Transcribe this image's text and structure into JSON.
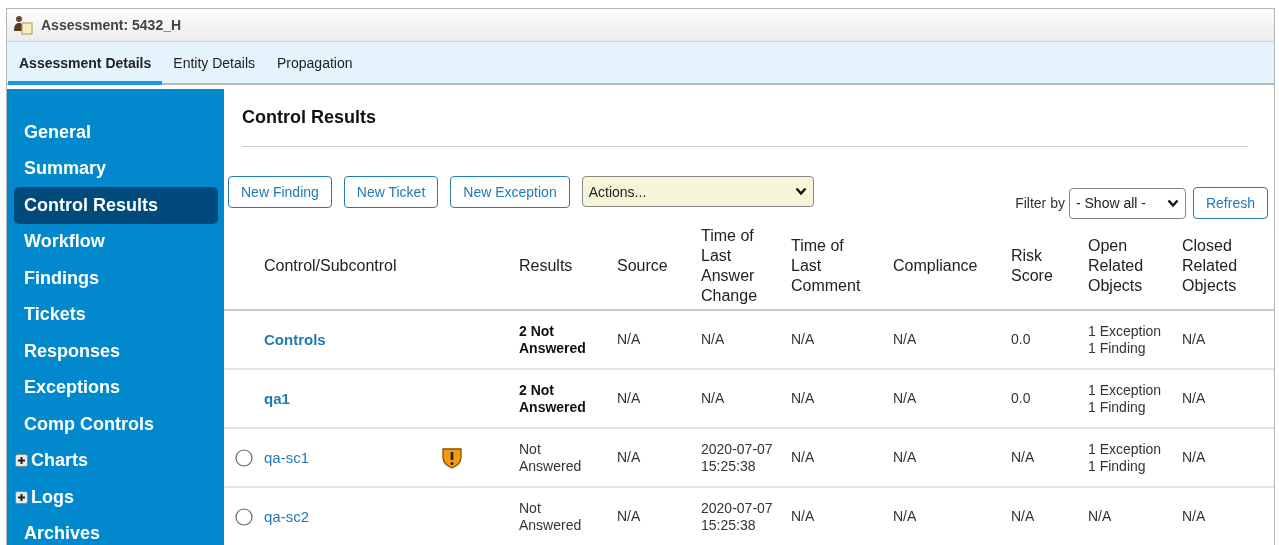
{
  "window": {
    "title": "Assessment: 5432_H"
  },
  "tabs": [
    {
      "label": "Assessment Details",
      "selected": true
    },
    {
      "label": "Entity Details",
      "selected": false
    },
    {
      "label": "Propagation",
      "selected": false
    }
  ],
  "sidebar": {
    "items": [
      {
        "label": "General",
        "selected": false,
        "expandable": false
      },
      {
        "label": "Summary",
        "selected": false,
        "expandable": false
      },
      {
        "label": "Control Results",
        "selected": true,
        "expandable": false
      },
      {
        "label": "Workflow",
        "selected": false,
        "expandable": false
      },
      {
        "label": "Findings",
        "selected": false,
        "expandable": false
      },
      {
        "label": "Tickets",
        "selected": false,
        "expandable": false
      },
      {
        "label": "Responses",
        "selected": false,
        "expandable": false
      },
      {
        "label": "Exceptions",
        "selected": false,
        "expandable": false
      },
      {
        "label": "Comp Controls",
        "selected": false,
        "expandable": false
      },
      {
        "label": "Charts",
        "selected": false,
        "expandable": true
      },
      {
        "label": "Logs",
        "selected": false,
        "expandable": true
      },
      {
        "label": "Archives",
        "selected": false,
        "expandable": false
      }
    ]
  },
  "content": {
    "heading": "Control Results",
    "buttons": [
      "New Finding",
      "New Ticket",
      "New Exception"
    ],
    "actions": {
      "value": "Actions..."
    },
    "filter": {
      "label": "Filter by",
      "value": "- Show all -"
    },
    "refresh": "Refresh"
  },
  "table": {
    "columns": [
      "Control/Subcontrol",
      "Results",
      "Source",
      "Time of Last Answer Change",
      "Time of Last Comment",
      "Compliance",
      "Risk Score",
      "Open Related Objects",
      "Closed Related Objects"
    ],
    "rows": [
      {
        "kind": "summary",
        "name": "Controls",
        "warning": false,
        "results": "2 Not Answered",
        "source": "N/A",
        "answer_change": "N/A",
        "last_comment": "N/A",
        "compliance": "N/A",
        "risk_score": "0.0",
        "open_related": [
          "1 Exception",
          "1 Finding"
        ],
        "closed_related": "N/A"
      },
      {
        "kind": "summary",
        "name": "qa1",
        "warning": false,
        "results": "2 Not Answered",
        "source": "N/A",
        "answer_change": "N/A",
        "last_comment": "N/A",
        "compliance": "N/A",
        "risk_score": "0.0",
        "open_related": [
          "1 Exception",
          "1 Finding"
        ],
        "closed_related": "N/A"
      },
      {
        "kind": "subcontrol",
        "selected": false,
        "name": "qa-sc1",
        "warning": true,
        "results": "Not Answered",
        "source": "N/A",
        "answer_change": "2020-07-07 15:25:38",
        "last_comment": "N/A",
        "compliance": "N/A",
        "risk_score": "N/A",
        "open_related": [
          "1 Exception",
          "1 Finding"
        ],
        "closed_related": "N/A"
      },
      {
        "kind": "subcontrol",
        "selected": false,
        "name": "qa-sc2",
        "warning": false,
        "results": "Not Answered",
        "source": "N/A",
        "answer_change": "2020-07-07 15:25:38",
        "last_comment": "N/A",
        "compliance": "N/A",
        "risk_score": "N/A",
        "open_related": [
          "N/A"
        ],
        "closed_related": "N/A"
      }
    ]
  }
}
